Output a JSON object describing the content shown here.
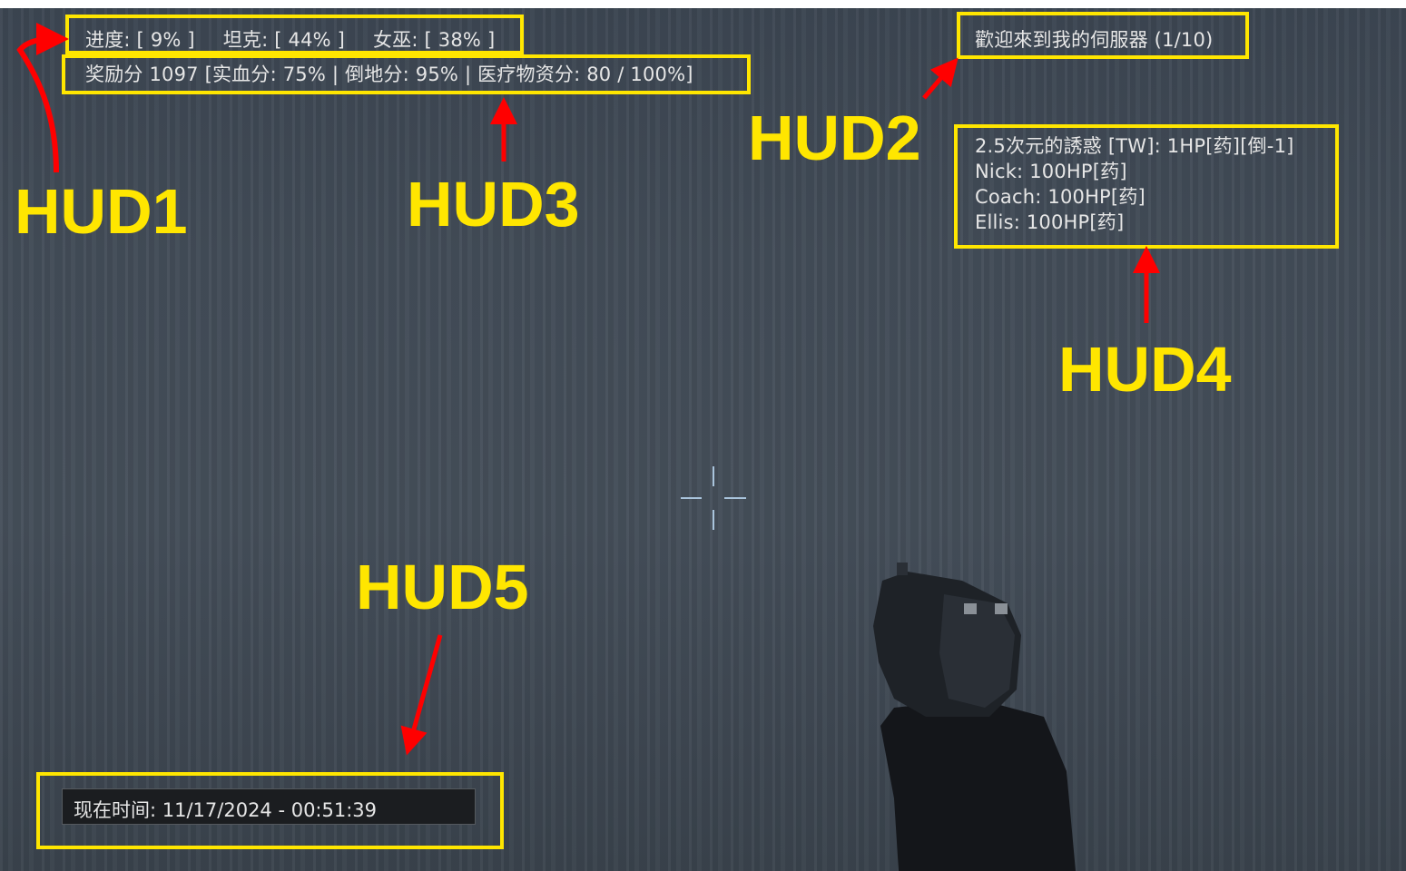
{
  "hud1": {
    "progress_label": "进度: [ 9% ]",
    "tank_label": "坦克: [ 44% ]",
    "witch_label": "女巫: [ 38% ]"
  },
  "hud2": {
    "welcome": "歡迎來到我的伺服器 (1/10)"
  },
  "hud3": {
    "score_line": "奖励分 1097 [实血分: 75% | 倒地分: 95% | 医疗物资分: 80 / 100%]"
  },
  "hud4": {
    "players": [
      "2.5次元的誘惑 [TW]: 1HP[药][倒-1]",
      "Nick: 100HP[药]",
      "Coach: 100HP[药]",
      "Ellis: 100HP[药]"
    ]
  },
  "hud5": {
    "time_text": "现在时间: 11/17/2024 - 00:51:39"
  },
  "annotations": {
    "hud1": "HUD1",
    "hud2": "HUD2",
    "hud3": "HUD3",
    "hud4": "HUD4",
    "hud5": "HUD5"
  },
  "colors": {
    "highlight": "#ffe600",
    "arrow": "#ff0000",
    "hud_text": "#e6e6e6"
  }
}
